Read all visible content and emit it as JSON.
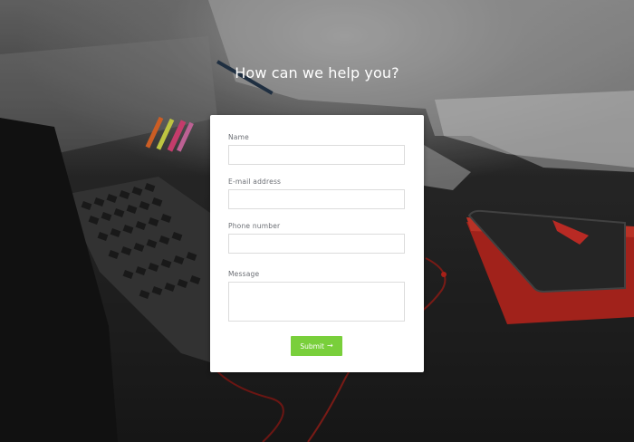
{
  "page": {
    "headline": "How can we help you?"
  },
  "form": {
    "fields": [
      {
        "label": "Name",
        "value": "",
        "placeholder": ""
      },
      {
        "label": "E-mail address",
        "value": "",
        "placeholder": ""
      },
      {
        "label": "Phone number",
        "value": "",
        "placeholder": ""
      },
      {
        "label": "Message",
        "value": "",
        "placeholder": ""
      }
    ],
    "submit_label": "Submit",
    "submit_icon": "arrow-right-icon"
  },
  "colors": {
    "accent": "#79cf3b",
    "card_bg": "#ffffff",
    "label_text": "#6b6e74",
    "input_border": "#dcdcdc"
  }
}
